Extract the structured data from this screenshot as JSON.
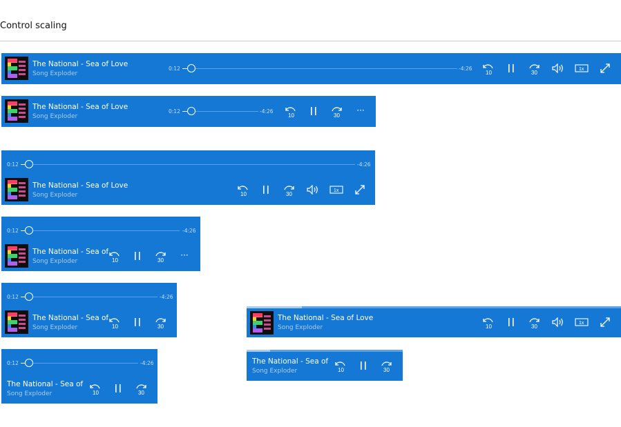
{
  "page": {
    "title": "Control scaling"
  },
  "track": {
    "title": "The National - Sea of Love",
    "title_short_1": "The National - Sea of",
    "title_short_2": "The National - Sea of Lc",
    "artist": "Song Exploder"
  },
  "progress": {
    "elapsed": "0:12",
    "remaining": "-4:26"
  },
  "controls": {
    "skip_back_label": "10",
    "skip_forward_label": "30",
    "rate_label": "1x",
    "more_label": "···"
  },
  "colors": {
    "accent": "#1478d4",
    "subtitle": "#a9cdf0"
  },
  "icons": [
    "skip-back-10-icon",
    "pause-icon",
    "skip-forward-30-icon",
    "volume-icon",
    "playback-rate-icon",
    "fullscreen-icon",
    "more-icon",
    "album-art"
  ]
}
